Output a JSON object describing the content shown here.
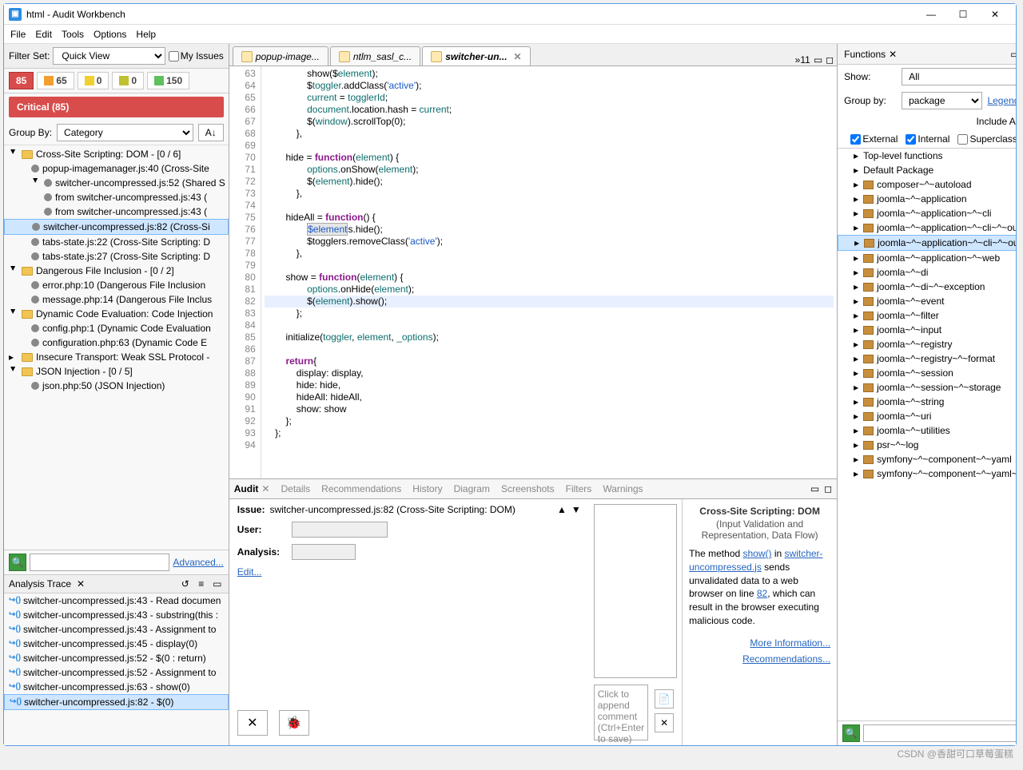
{
  "title": "html - Audit Workbench",
  "menu": [
    "File",
    "Edit",
    "Tools",
    "Options",
    "Help"
  ],
  "filter_label": "Filter Set:",
  "filter_value": "Quick View",
  "my_issues": "My Issues",
  "severity": [
    {
      "cls": "sev-crit",
      "n": "85"
    },
    {
      "cls": "sev-high",
      "n": "65"
    },
    {
      "cls": "sev-med",
      "n": "0"
    },
    {
      "cls": "sev-med2",
      "n": "0"
    },
    {
      "cls": "sev-low",
      "n": "150"
    }
  ],
  "crit_header": "Critical (85)",
  "group_by_label": "Group By:",
  "group_by_value": "Category",
  "issue_tree": [
    {
      "t": "cat",
      "txt": "Cross-Site Scripting: DOM - [0 / 6]"
    },
    {
      "t": "leaf",
      "lvl": 2,
      "txt": "popup-imagemanager.js:40 (Cross-Site"
    },
    {
      "t": "sub",
      "lvl": 2,
      "txt": "switcher-uncompressed.js:52 (Shared S"
    },
    {
      "t": "leaf",
      "lvl": 3,
      "txt": "from switcher-uncompressed.js:43 ("
    },
    {
      "t": "leaf",
      "lvl": 3,
      "txt": "from switcher-uncompressed.js:43 ("
    },
    {
      "t": "leaf",
      "lvl": 2,
      "sel": true,
      "txt": "switcher-uncompressed.js:82 (Cross-Si"
    },
    {
      "t": "leaf",
      "lvl": 2,
      "txt": "tabs-state.js:22 (Cross-Site Scripting: D"
    },
    {
      "t": "leaf",
      "lvl": 2,
      "txt": "tabs-state.js:27 (Cross-Site Scripting: D"
    },
    {
      "t": "cat",
      "txt": "Dangerous File Inclusion - [0 / 2]"
    },
    {
      "t": "leaf",
      "lvl": 2,
      "txt": "error.php:10 (Dangerous File Inclusion"
    },
    {
      "t": "leaf",
      "lvl": 2,
      "txt": "message.php:14 (Dangerous File Inclus"
    },
    {
      "t": "cat",
      "txt": "Dynamic Code Evaluation: Code Injection"
    },
    {
      "t": "leaf",
      "lvl": 2,
      "txt": "config.php:1 (Dynamic Code Evaluation"
    },
    {
      "t": "leaf",
      "lvl": 2,
      "txt": "configuration.php:63 (Dynamic Code E"
    },
    {
      "t": "cat",
      "collapsed": true,
      "txt": "Insecure Transport: Weak SSL Protocol -"
    },
    {
      "t": "cat",
      "txt": "JSON Injection - [0 / 5]"
    },
    {
      "t": "leaf",
      "lvl": 2,
      "txt": "json.php:50 (JSON Injection)"
    }
  ],
  "advanced": "Advanced...",
  "trace_title": "Analysis Trace",
  "trace": [
    "switcher-uncompressed.js:43 - Read documen",
    "switcher-uncompressed.js:43 - substring(this :",
    "switcher-uncompressed.js:43 - Assignment to",
    "switcher-uncompressed.js:45 - display(0)",
    "switcher-uncompressed.js:52 - $(0 : return)",
    "switcher-uncompressed.js:52 - Assignment to",
    "switcher-uncompressed.js:63 - show(0)",
    "switcher-uncompressed.js:82 - $(0)"
  ],
  "trace_selected": 7,
  "editor_tabs": [
    {
      "txt": "popup-image..."
    },
    {
      "txt": "ntlm_sasl_c..."
    },
    {
      "txt": "switcher-un...",
      "active": true,
      "close": true
    }
  ],
  "tab_count": "»11",
  "code_start": 63,
  "code": [
    "                show($element);",
    "                $toggler.addClass('active');",
    "                current = togglerId;",
    "                document.location.hash = current;",
    "                $(window).scrollTop(0);",
    "            },",
    "",
    "        hide = function(element) {",
    "                options.onShow(element);",
    "                $(element).hide();",
    "            },",
    "",
    "        hideAll = function() {",
    "                $elements.hide();",
    "                $togglers.removeClass('active');",
    "            },",
    "",
    "        show = function(element) {",
    "                options.onHide(element);",
    "                $(element).show();",
    "            };",
    "",
    "        initialize(toggler, element, _options);",
    "",
    "        return{",
    "            display: display,",
    "            hide: hide,",
    "            hideAll: hideAll,",
    "            show: show",
    "        };",
    "    };",
    ""
  ],
  "code_hl_line": 82,
  "audit_tabs": [
    "Audit",
    "Details",
    "Recommendations",
    "History",
    "Diagram",
    "Screenshots",
    "Filters",
    "Warnings"
  ],
  "audit_active": 0,
  "issue_label": "Issue:",
  "issue_text": "switcher-uncompressed.js:82 (Cross-Site Scripting: DOM)",
  "user_label": "User:",
  "analysis_label": "Analysis:",
  "edit_label": "Edit...",
  "comment_placeholder": "Click to append comment (Ctrl+Enter to save)",
  "summary_title": "Cross-Site Scripting: DOM",
  "summary_sub": "(Input Validation and Representation, Data Flow)",
  "summary_body_pre": "The method ",
  "summary_show": "show()",
  "summary_body_mid": " in ",
  "summary_file": "switcher-uncompressed.js",
  "summary_body_post1": " sends unvalidated data to a web browser on line ",
  "summary_line": "82",
  "summary_body_post2": ", which can result in the browser executing malicious code.",
  "more_info": "More Information...",
  "recs": "Recommendations...",
  "fn_title": "Functions",
  "fn_show_lbl": "Show:",
  "fn_show_val": "All",
  "fn_group_lbl": "Group by:",
  "fn_group_val": "package",
  "legend": "Legend...",
  "include_api": "Include API:",
  "chk_ext": "External",
  "chk_int": "Internal",
  "chk_sup": "Superclasses",
  "packages": [
    "Top-level functions",
    "Default Package",
    "composer~^~autoload",
    "joomla~^~application",
    "joomla~^~application~^~cli",
    "joomla~^~application~^~cli~^~outp",
    "joomla~^~application~^~cli~^~outp",
    "joomla~^~application~^~web",
    "joomla~^~di",
    "joomla~^~di~^~exception",
    "joomla~^~event",
    "joomla~^~filter",
    "joomla~^~input",
    "joomla~^~registry",
    "joomla~^~registry~^~format",
    "joomla~^~session",
    "joomla~^~session~^~storage",
    "joomla~^~string",
    "joomla~^~uri",
    "joomla~^~utilities",
    "psr~^~log",
    "symfony~^~component~^~yaml",
    "symfony~^~component~^~yaml~^~"
  ],
  "pkg_selected": 6,
  "watermark": "CSDN @香甜可口草莓蛋糕"
}
